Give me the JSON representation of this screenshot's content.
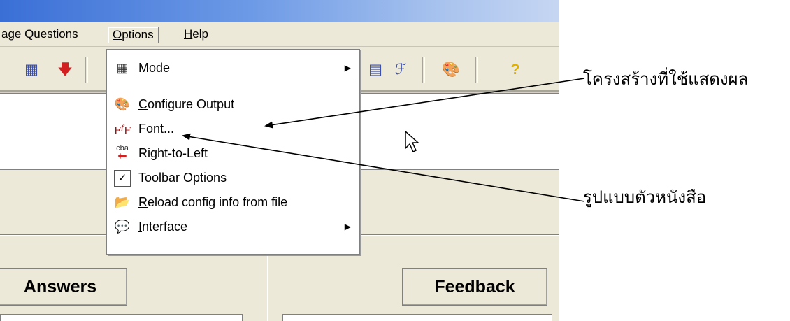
{
  "menubar": {
    "items": [
      {
        "label": "age Questions"
      },
      {
        "label": "Options",
        "accel": "O",
        "rest": "ptions"
      },
      {
        "label": "Help",
        "accel": "H",
        "rest": "elp"
      }
    ]
  },
  "options_menu": {
    "items": [
      {
        "icon": "mode-icon",
        "accel": "M",
        "rest": "ode",
        "submenu": true
      },
      {
        "icon": "configure-output-icon",
        "accel": "C",
        "rest": "onfigure Output"
      },
      {
        "icon": "font-icon",
        "accel": "F",
        "rest": "ont..."
      },
      {
        "icon": "right-to-left-icon",
        "accel": "",
        "rest": "Right-to-Left"
      },
      {
        "icon": "toolbar-options-icon",
        "accel": "T",
        "rest": "oolbar Options"
      },
      {
        "icon": "reload-config-icon",
        "accel": "R",
        "rest": "eload config info from file"
      },
      {
        "icon": "interface-icon",
        "accel": "I",
        "rest": "nterface",
        "submenu": true
      }
    ]
  },
  "buttons": {
    "answers": "Answers",
    "feedback": "Feedback"
  },
  "annotations": {
    "output_structure": "โครงสร้างที่ใช้แสดงผล",
    "font_format": "รูปแบบตัวหนังสือ"
  }
}
